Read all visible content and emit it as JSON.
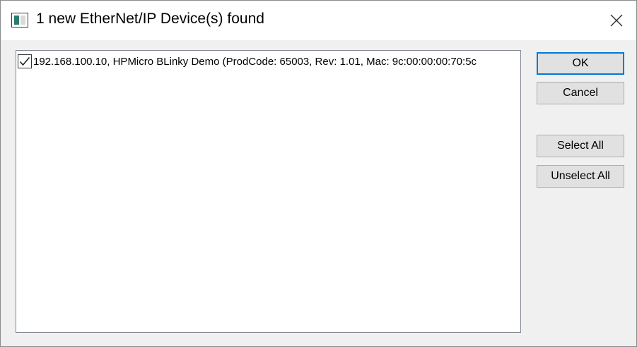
{
  "window": {
    "title": "1 new EtherNet/IP Device(s) found",
    "icon": "window-app-icon",
    "close_icon": "close-icon"
  },
  "device_list": {
    "items": [
      {
        "checked": true,
        "label": "192.168.100.10, HPMicro BLinky Demo (ProdCode: 65003, Rev: 1.01, Mac: 9c:00:00:00:70:5c"
      }
    ]
  },
  "buttons": {
    "ok": "OK",
    "cancel": "Cancel",
    "select_all": "Select All",
    "unselect_all": "Unselect All"
  },
  "colors": {
    "dialog_background": "#f0f0f0",
    "default_button_border": "#0078d7",
    "icon_accent": "#2a7c6f"
  }
}
